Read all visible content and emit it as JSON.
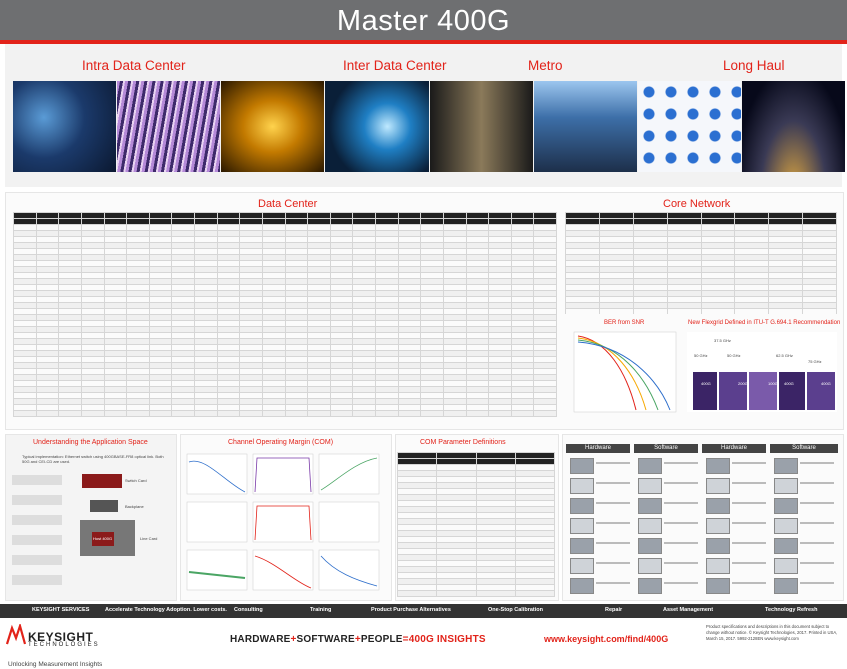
{
  "header": {
    "title": "Master 400G"
  },
  "segments": [
    "Intra Data Center",
    "Inter Data Center",
    "Metro",
    "Long Haul"
  ],
  "sections": {
    "data_center": "Data Center",
    "core_network": "Core Network",
    "ber": "BER from SNR",
    "grid": "New Flexgrid Defined in ITU-T G.694.1 Recommendation",
    "app_space": "Understanding the Application Space",
    "com": "Channel Operating Margin (COM)",
    "com_params": "COM Parameter Definitions",
    "hardware": "Hardware",
    "software": "Software"
  },
  "app_space_note": "Typical implementation: Ethernet switch using 400GBASE-FR8 optical link. Both 50G and CEI-CD are used.",
  "app_space_labels": [
    "Switch Card",
    "Backplane",
    "Line Card",
    "Host 400G"
  ],
  "flexgrid": {
    "labels": [
      "37.5 GHz",
      "50 GHz",
      "50 GHz",
      "62.5 GHz",
      "75 GHz"
    ],
    "dots": [
      "400G",
      "200G",
      "100G",
      "400G",
      "400G"
    ]
  },
  "footer": {
    "services_label": "KEYSIGHT SERVICES",
    "services_tagline": "Accelerate Technology Adoption. Lower costs.",
    "services": [
      "Consulting",
      "Training",
      "Product Purchase Alternatives",
      "One-Stop Calibration",
      "Repair",
      "Asset Management",
      "Technology Refresh"
    ],
    "brand": "KEYSIGHT",
    "brand_sub": "TECHNOLOGIES",
    "brand_tag": "Unlocking Measurement Insights",
    "tag_hw": "HARDWARE",
    "tag_plus": "+",
    "tag_sw": "SOFTWARE",
    "tag_people": "PEOPLE",
    "tag_eq": "=",
    "tag_result": "400G INSIGHTS",
    "url": "www.keysight.com/find/400G",
    "fine": "Product specifications and descriptions in this document subject to change without notice. © Keysight Technologies, 2017. Printed in USA, March 15, 2017. 5992-2128EN www.keysight.com"
  }
}
